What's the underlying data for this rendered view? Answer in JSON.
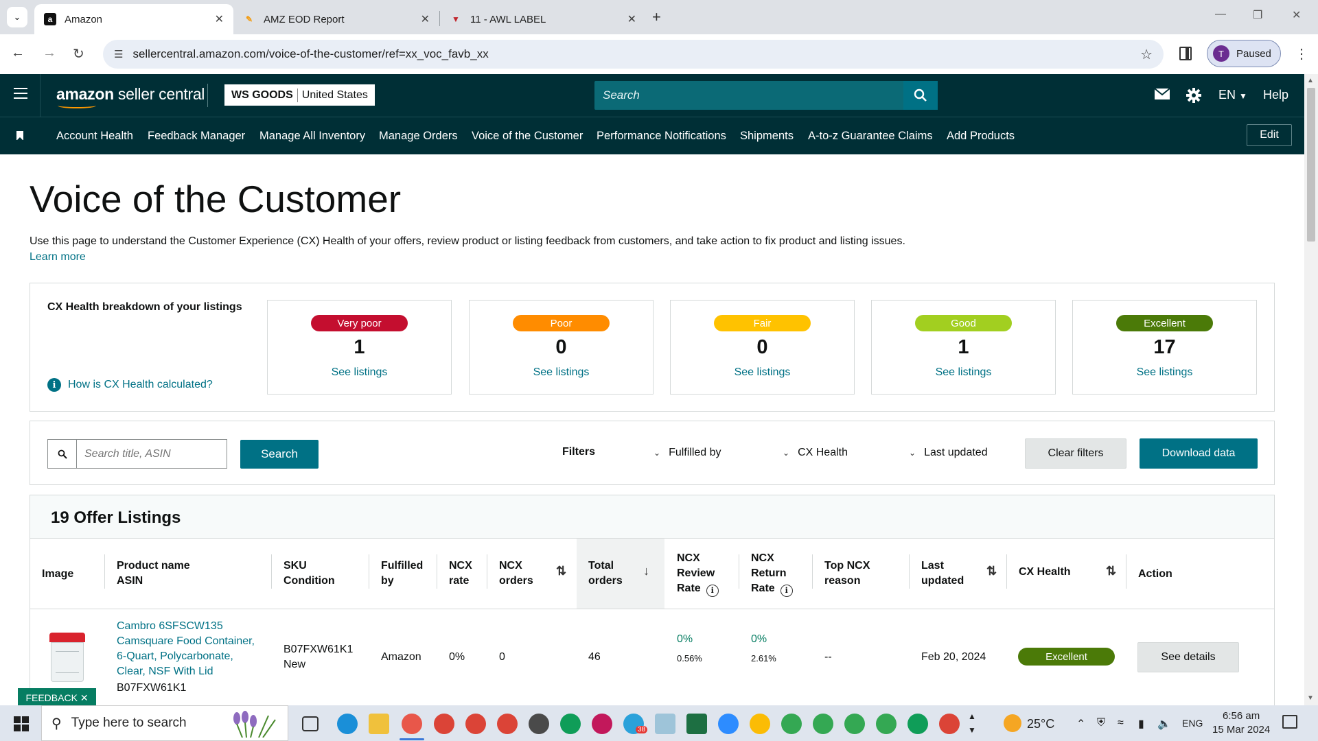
{
  "browser": {
    "tabs": [
      {
        "title": "Amazon",
        "favicon": "amazon-icon",
        "active": true
      },
      {
        "title": "AMZ EOD Report",
        "favicon": "report-icon",
        "active": false
      },
      {
        "title": "11 - AWL LABEL",
        "favicon": "label-icon",
        "active": false
      }
    ],
    "url": "sellercentral.amazon.com/voice-of-the-customer/ref=xx_voc_favb_xx",
    "profile_initial": "T",
    "profile_status": "Paused"
  },
  "header": {
    "logo_bold": "amazon",
    "logo_rest": " seller central",
    "store_name": "WS GOODS",
    "store_region": "United States",
    "search_placeholder": "Search",
    "language": "EN",
    "help": "Help"
  },
  "nav": {
    "items": [
      "Account Health",
      "Feedback Manager",
      "Manage All Inventory",
      "Manage Orders",
      "Voice of the Customer",
      "Performance Notifications",
      "Shipments",
      "A-to-z Guarantee Claims",
      "Add Products"
    ],
    "edit": "Edit"
  },
  "page": {
    "title": "Voice of the Customer",
    "description": "Use this page to understand the Customer Experience (CX) Health of your offers, review product or listing feedback from customers, and take action to fix product and listing issues.",
    "learn_more": "Learn more"
  },
  "cx_health": {
    "label": "CX Health breakdown of your listings",
    "help_link": "How is CX Health calculated?",
    "cards": [
      {
        "status": "Very poor",
        "count": "1",
        "link": "See listings",
        "color": "#c40e2f"
      },
      {
        "status": "Poor",
        "count": "0",
        "link": "See listings",
        "color": "#ff8c00"
      },
      {
        "status": "Fair",
        "count": "0",
        "link": "See listings",
        "color": "#ffc200"
      },
      {
        "status": "Good",
        "count": "1",
        "link": "See listings",
        "color": "#a2cf20"
      },
      {
        "status": "Excellent",
        "count": "17",
        "link": "See listings",
        "color": "#4b7a08"
      }
    ]
  },
  "filters": {
    "search_placeholder": "Search title, ASIN",
    "search_button": "Search",
    "label": "Filters",
    "dropdowns": [
      "Fulfilled by",
      "CX Health",
      "Last updated"
    ],
    "clear": "Clear filters",
    "download": "Download data"
  },
  "table": {
    "title": "19 Offer Listings",
    "columns": {
      "image": "Image",
      "product_line1": "Product name",
      "product_line2": "ASIN",
      "sku_line1": "SKU",
      "sku_line2": "Condition",
      "fulfilled_line1": "Fulfilled",
      "fulfilled_line2": "by",
      "ncx_rate_line1": "NCX",
      "ncx_rate_line2": "rate",
      "ncx_orders_line1": "NCX",
      "ncx_orders_line2": "orders",
      "total_line1": "Total",
      "total_line2": "orders",
      "review_line1": "NCX",
      "review_line2": "Review",
      "review_line3": "Rate",
      "return_line1": "NCX",
      "return_line2": "Return",
      "return_line3": "Rate",
      "reason_line1": "Top NCX",
      "reason_line2": "reason",
      "updated_line1": "Last",
      "updated_line2": "updated",
      "cx_health": "CX Health",
      "action": "Action"
    },
    "rows": [
      {
        "product_name": "Cambro 6SFSCW135 Camsquare Food Container, 6-Quart, Polycarbonate, Clear, NSF With Lid",
        "asin": "B07FXW61K1",
        "sku": "B07FXW61K1",
        "condition": "New",
        "fulfilled_by": "Amazon",
        "ncx_rate": "0%",
        "ncx_orders": "0",
        "total_orders": "46",
        "review_rate": "0%",
        "review_rate_sub": "0.56%",
        "return_rate": "0%",
        "return_rate_sub": "2.61%",
        "top_reason": "--",
        "last_updated": "Feb 20, 2024",
        "cx_health": "Excellent",
        "action": "See details"
      }
    ]
  },
  "feedback_tab": "FEEDBACK",
  "taskbar": {
    "search_placeholder": "Type here to search",
    "temperature": "25°C",
    "language": "ENG",
    "time": "6:56 am",
    "date": "15 Mar 2024",
    "telegram_badge": "38"
  }
}
